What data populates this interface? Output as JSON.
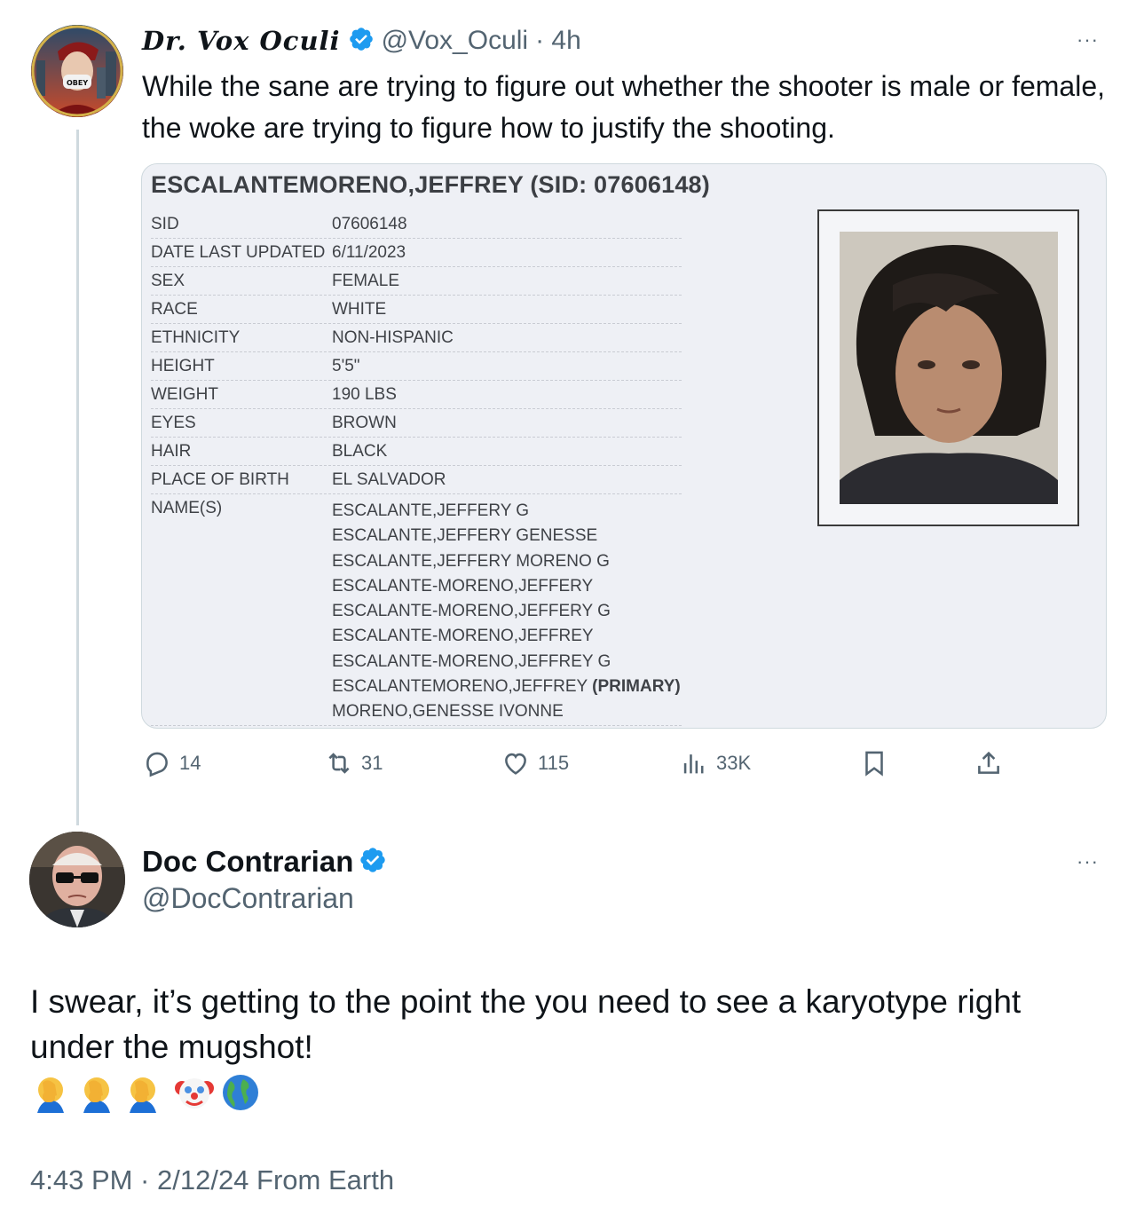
{
  "tweet1": {
    "display_name": "Dr. Vox Oculi",
    "handle": "@Vox_Oculi",
    "time": "· 4h",
    "text": "While the sane are trying to figure out whether the shooter is male or female, the woke are trying to figure how to justify the shooting.",
    "more": "···",
    "avatar_text": "OBEY",
    "card": {
      "title": "ESCALANTEMORENO,JEFFREY (SID: 07606148)",
      "rows": [
        {
          "key": "SID",
          "value": "07606148"
        },
        {
          "key": "DATE LAST UPDATED",
          "value": "6/11/2023"
        },
        {
          "key": "SEX",
          "value": "FEMALE"
        },
        {
          "key": "RACE",
          "value": "WHITE"
        },
        {
          "key": "ETHNICITY",
          "value": "NON-HISPANIC"
        },
        {
          "key": "HEIGHT",
          "value": "5'5\""
        },
        {
          "key": "WEIGHT",
          "value": "190 LBS"
        },
        {
          "key": "EYES",
          "value": "BROWN"
        },
        {
          "key": "HAIR",
          "value": "BLACK"
        },
        {
          "key": "PLACE OF BIRTH",
          "value": "EL SALVADOR"
        }
      ],
      "names_label": "NAME(S)",
      "names": [
        "ESCALANTE,JEFFERY G",
        "ESCALANTE,JEFFERY GENESSE",
        "ESCALANTE,JEFFERY MORENO G",
        "ESCALANTE-MORENO,JEFFERY",
        "ESCALANTE-MORENO,JEFFERY G",
        "ESCALANTE-MORENO,JEFFREY",
        "ESCALANTE-MORENO,JEFFREY G"
      ],
      "primary_name": "ESCALANTEMORENO,JEFFREY",
      "primary_tag": "(PRIMARY)",
      "last_name": "MORENO,GENESSE IVONNE"
    },
    "actions": {
      "replies": "14",
      "reposts": "31",
      "likes": "115",
      "views": "33K"
    }
  },
  "tweet2": {
    "display_name": "Doc Contrarian",
    "handle": "@DocContrarian",
    "more": "···",
    "text": "I swear, it’s getting to the point the you need to see a karyotype right under the mugshot!",
    "emojis": [
      "facepalm",
      "facepalm",
      "facepalm",
      "clown",
      "globe"
    ],
    "timestamp": "4:43 PM · 2/12/24 From Earth"
  },
  "colors": {
    "verified_blue": "#1d9bf0",
    "secondary_text": "#536471",
    "primary_text": "#0f1419",
    "thread_line": "#cfd9de"
  }
}
